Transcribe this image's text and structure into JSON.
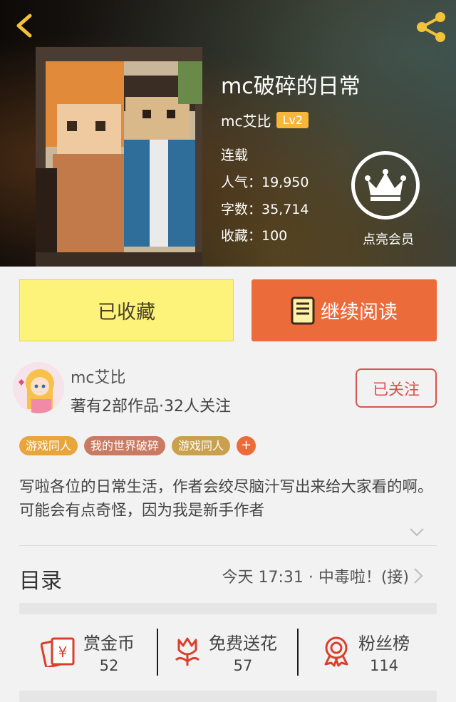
{
  "book": {
    "title": "mc破碎的日常",
    "author": "mc艾比",
    "level": "Lv2",
    "status": "连载",
    "popularity": "人气：19,950",
    "words": "字数：35,714",
    "favorites": "收藏：100",
    "member_label": "点亮会员"
  },
  "actions": {
    "collected_label": "已收藏",
    "continue_label": "继续阅读"
  },
  "author_card": {
    "name": "mc艾比",
    "meta": "著有2部作品·32人关注",
    "follow_label": "已关注"
  },
  "tags": [
    {
      "label": "游戏同人",
      "color": "#e8a63a"
    },
    {
      "label": "我的世界破碎",
      "color": "#c97a62"
    },
    {
      "label": "游戏同人",
      "color": "#c9a14e"
    }
  ],
  "tag_add": "+",
  "description": "写啦各位的日常生活，作者会绞尽脑汁写出来给大家看的啊。可能会有点奇怪，因为我是新手作者",
  "toc": {
    "label": "目录",
    "latest": "今天 17:31 · 中毒啦！(接)"
  },
  "stats": [
    {
      "label": "赏金币",
      "value": "52",
      "icon": "red-envelope-icon"
    },
    {
      "label": "免费送花",
      "value": "57",
      "icon": "flower-icon"
    },
    {
      "label": "粉丝榜",
      "value": "114",
      "icon": "medal-icon"
    }
  ],
  "colors": {
    "accent": "#ec6b3b",
    "collected_bg": "#fdf27a",
    "follow": "#d9534f",
    "icon_red": "#d9402b"
  }
}
